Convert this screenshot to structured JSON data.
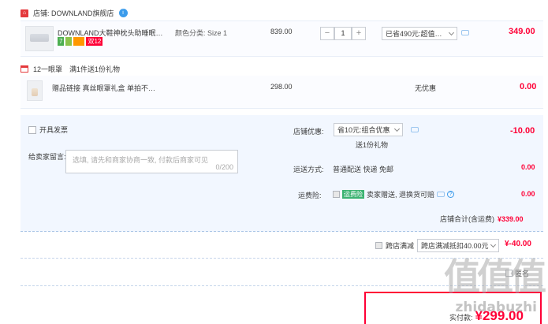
{
  "shop": {
    "label": "店铺: DOWNLAND旗舰店",
    "ww_badge": "i"
  },
  "item": {
    "title": "DOWNLAND大鞋神枕头助睡眠…",
    "spec": "颜色分类: Size 1",
    "badges": [
      {
        "text": "7",
        "color": "#4caf50"
      },
      {
        "text": "",
        "color": "#ff9800"
      },
      {
        "text": "",
        "color": "#ff9800"
      },
      {
        "text": "双12",
        "color": "#ff0036"
      }
    ],
    "unit_price": "839.00",
    "quantity": "1",
    "minus": "−",
    "plus": "+",
    "discount_select": "已省490元:超值…",
    "subtotal": "349.00"
  },
  "gift_header": "12一眼罩　满1件送1份礼物",
  "gift_item": {
    "title": "赠品链接 真丝眼罩礼盒 单拍不…",
    "unit_price": "298.00",
    "promo": "无优惠",
    "subtotal": "0.00"
  },
  "invoice": {
    "label": "开具发票"
  },
  "message": {
    "label": "给卖家留言:",
    "placeholder": "选填, 请先和商家协商一致, 付款后商家可见",
    "counter": "0/200"
  },
  "shop_coupon": {
    "label": "店铺优惠:",
    "select": "省10元:组合优惠",
    "gift_note": "送1份礼物",
    "amount": "-10.00"
  },
  "delivery": {
    "label": "运送方式:",
    "value": "普通配送 快递 免邮",
    "amount": "0.00"
  },
  "insurance": {
    "label": "运费险:",
    "chip": "运费险",
    "text": "卖家赠送, 退换货可赔",
    "help": "?",
    "amount": "0.00"
  },
  "shop_total": {
    "label": "店铺合计(含运费)",
    "amount": "¥339.00"
  },
  "cross_store": {
    "label": "跨店满减",
    "select": "跨店满减抵扣40.00元",
    "amount": "¥-40.00"
  },
  "anon": {
    "label": "匿名"
  },
  "payment": {
    "label": "实付款:",
    "amount": "¥299.00"
  },
  "watermark": {
    "big": "值值值",
    "small": "zhidabuzhi"
  }
}
